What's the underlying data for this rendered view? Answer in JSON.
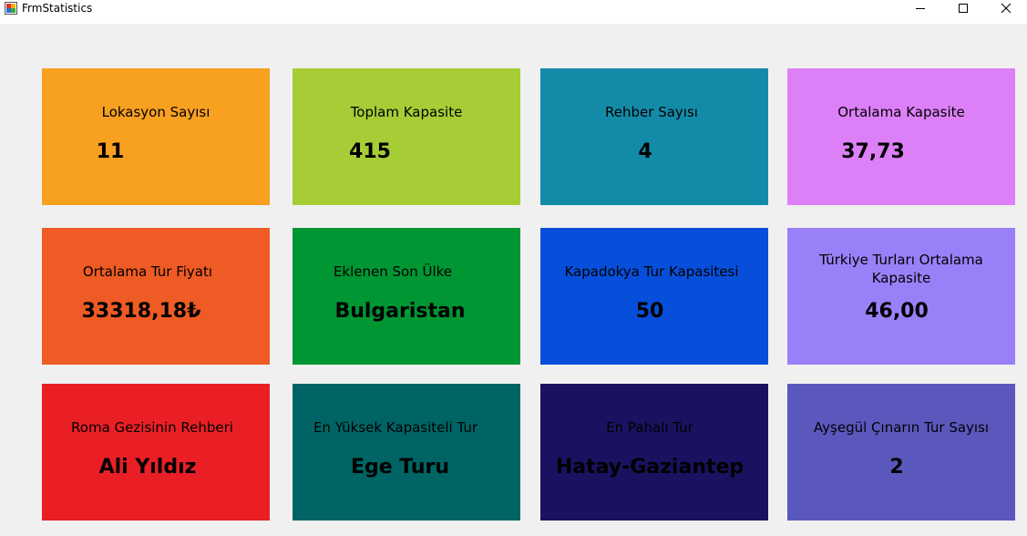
{
  "window": {
    "title": "FrmStatistics",
    "icon": "winforms-app-icon"
  },
  "cards": [
    {
      "label": "Lokasyon Sayısı",
      "value": "11",
      "color": "#f8a020"
    },
    {
      "label": "Toplam Kapasite",
      "value": "415",
      "color": "#a6cd36"
    },
    {
      "label": "Rehber Sayısı",
      "value": "4",
      "color": "#138ba8"
    },
    {
      "label": "Ortalama Kapasite",
      "value": "37,73",
      "color": "#dd80f8"
    },
    {
      "label": "Ortalama Tur Fiyatı",
      "value": "33318,18₺",
      "color": "#ee5b24"
    },
    {
      "label": "Eklenen Son Ülke",
      "value": "Bulgaristan",
      "color": "#009633"
    },
    {
      "label": "Kapadokya Tur Kapasitesi",
      "value": "50",
      "color": "#074fda"
    },
    {
      "label": "Türkiye Turları Ortalama Kapasite",
      "value": "46,00",
      "color": "#9a80f8"
    },
    {
      "label": "Roma Gezisinin Rehberi",
      "value": "Ali Yıldız",
      "color": "#ea1f26"
    },
    {
      "label": "En Yüksek Kapasiteli Tur",
      "value": "Ege Turu",
      "color": "#006464"
    },
    {
      "label": "En Pahalı Tur",
      "value": "Hatay-Gaziantep",
      "color": "#1a1260"
    },
    {
      "label": "Ayşegül Çınarın Tur Sayısı",
      "value": "2",
      "color": "#5a58bc"
    }
  ]
}
